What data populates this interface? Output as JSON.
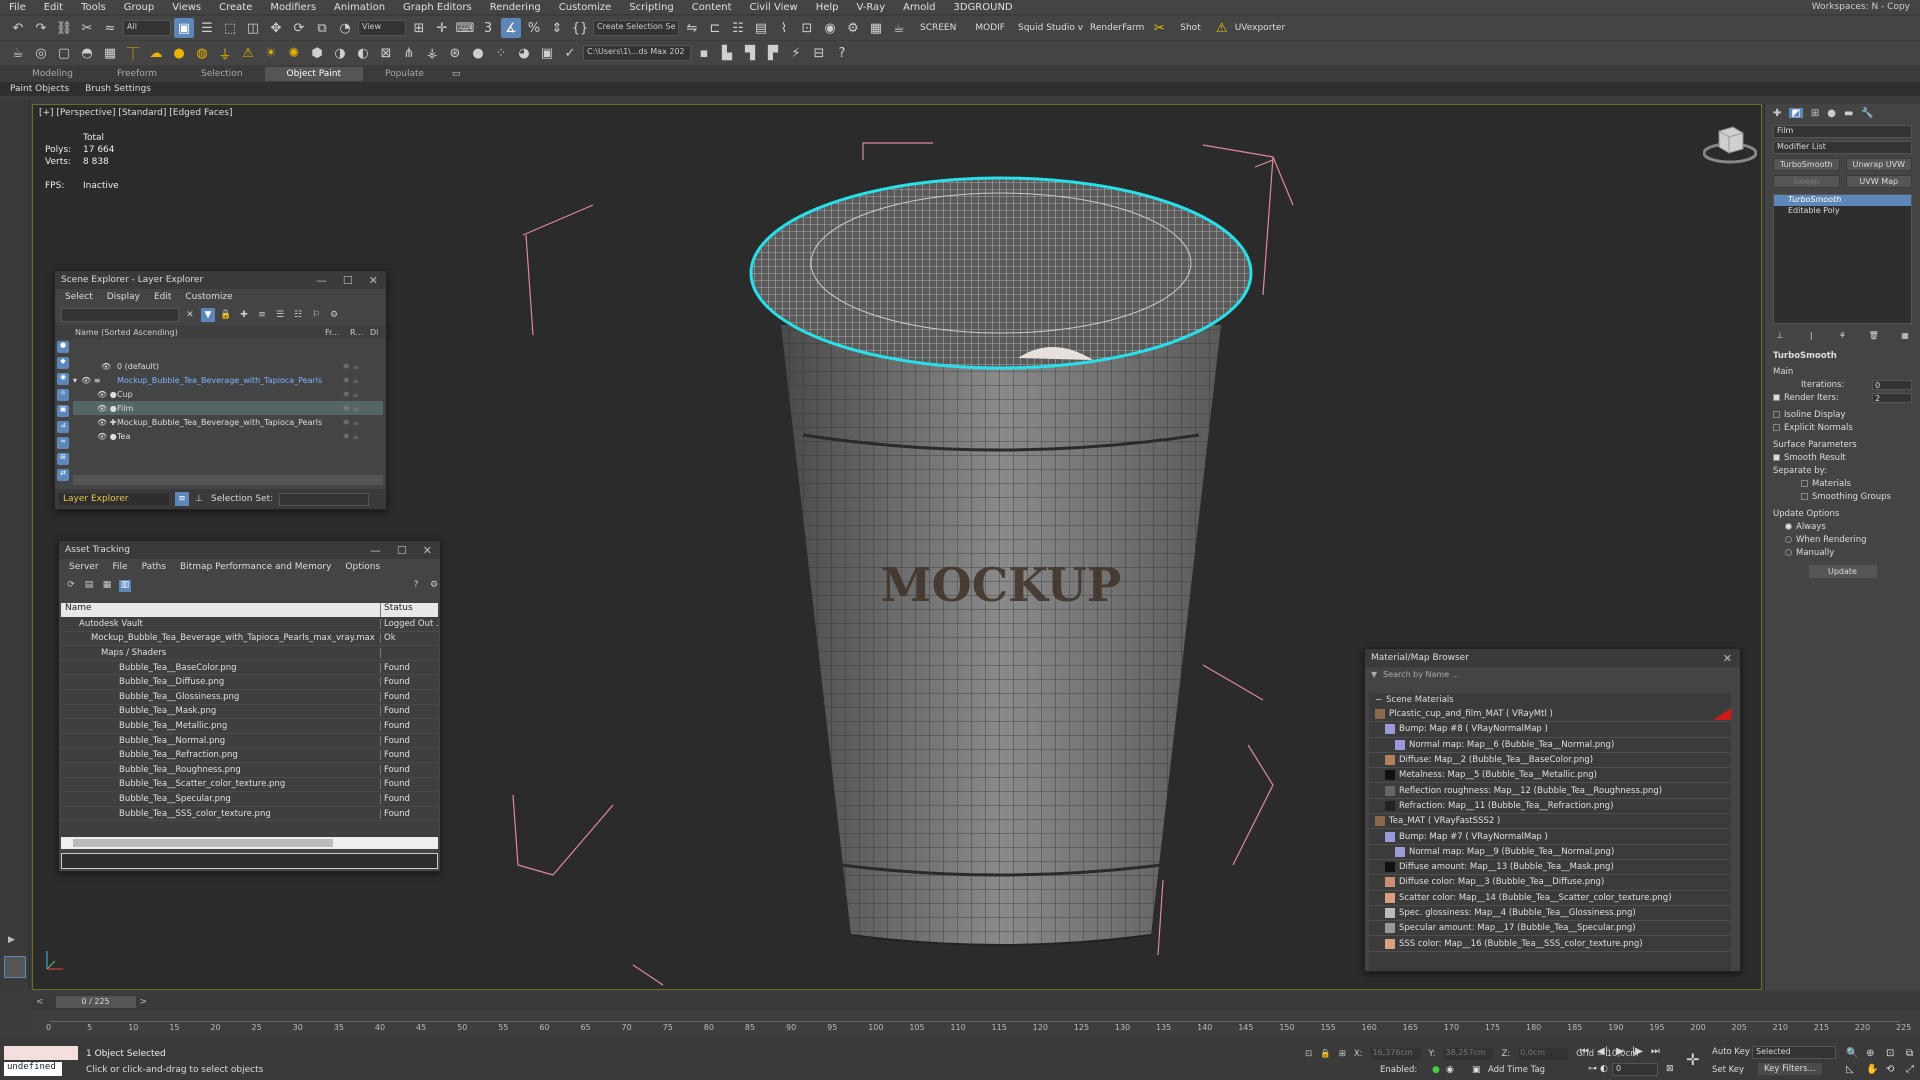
{
  "menubar": {
    "items": [
      "File",
      "Edit",
      "Tools",
      "Group",
      "Views",
      "Create",
      "Modifiers",
      "Animation",
      "Graph Editors",
      "Rendering",
      "Customize",
      "Scripting",
      "Content",
      "Civil View",
      "Help",
      "V-Ray",
      "Arnold",
      "3DGROUND"
    ],
    "workspaces": "Workspaces:  N - Copy"
  },
  "toolbar1": {
    "filter_value": "All",
    "view_value": "View",
    "selection_set_placeholder": "Create Selection Se",
    "screen_label": "SCREEN",
    "modif_label": "MODIF",
    "squid_label": "Squid Studio v",
    "renderfarm_label": "RenderFarm",
    "shot_label": "Shot",
    "uvexporter_label": "UVexporter"
  },
  "toolbar2": {
    "path_value": "C:\\Users\\1\\...ds Max 202"
  },
  "ribbon": {
    "tabs": [
      "Modeling",
      "Freeform",
      "Selection",
      "Object Paint",
      "Populate"
    ],
    "active_tab": "Object Paint",
    "subtabs": [
      "Paint Objects",
      "Brush Settings"
    ]
  },
  "viewport": {
    "label": "[+] [Perspective] [Standard] [Edged Faces]",
    "stats": {
      "total_label": "Total",
      "polys_label": "Polys:",
      "polys_value": "17 664",
      "verts_label": "Verts:",
      "verts_value": "8 838",
      "fps_label": "FPS:",
      "fps_value": "Inactive"
    },
    "cup_text": "MOCKUP"
  },
  "scene_explorer": {
    "title": "Scene Explorer - Layer Explorer",
    "menu": [
      "Select",
      "Display",
      "Edit",
      "Customize"
    ],
    "columns": [
      "Name (Sorted Ascending)",
      "Fr...",
      "R...",
      "Di"
    ],
    "rows": [
      {
        "label": "0 (default)",
        "indent": 1
      },
      {
        "label": "Mockup_Bubble_Tea_Beverage_with_Tapioca_Pearls",
        "indent": 0
      },
      {
        "label": "Cup",
        "indent": 2
      },
      {
        "label": "Film",
        "indent": 2
      },
      {
        "label": "Mockup_Bubble_Tea_Beverage_with_Tapioca_Pearls",
        "indent": 2
      },
      {
        "label": "Tea",
        "indent": 2
      }
    ],
    "footer_layer": "Layer Explorer",
    "selection_set_label": "Selection Set:"
  },
  "asset_tracking": {
    "title": "Asset Tracking",
    "menu": [
      "Server",
      "File",
      "Paths",
      "Bitmap Performance and Memory",
      "Options"
    ],
    "columns": [
      "Name",
      "Status"
    ],
    "rows": [
      {
        "name": "Autodesk Vault",
        "status": "Logged Out ..."
      },
      {
        "name": "Mockup_Bubble_Tea_Beverage_with_Tapioca_Pearls_max_vray.max",
        "status": "Ok"
      },
      {
        "name": "Maps / Shaders",
        "status": ""
      },
      {
        "name": "Bubble_Tea__BaseColor.png",
        "status": "Found"
      },
      {
        "name": "Bubble_Tea__Diffuse.png",
        "status": "Found"
      },
      {
        "name": "Bubble_Tea__Glossiness.png",
        "status": "Found"
      },
      {
        "name": "Bubble_Tea__Mask.png",
        "status": "Found"
      },
      {
        "name": "Bubble_Tea__Metallic.png",
        "status": "Found"
      },
      {
        "name": "Bubble_Tea__Normal.png",
        "status": "Found"
      },
      {
        "name": "Bubble_Tea__Refraction.png",
        "status": "Found"
      },
      {
        "name": "Bubble_Tea__Roughness.png",
        "status": "Found"
      },
      {
        "name": "Bubble_Tea__Scatter_color_texture.png",
        "status": "Found"
      },
      {
        "name": "Bubble_Tea__Specular.png",
        "status": "Found"
      },
      {
        "name": "Bubble_Tea__SSS_color_texture.png",
        "status": "Found"
      }
    ]
  },
  "material_browser": {
    "title": "Material/Map Browser",
    "search_placeholder": "Search by Name ...",
    "section": "Scene Materials",
    "rows": [
      {
        "label": "Plcastic_cup_and_film_MAT  ( VRayMtl )",
        "swatch": "#8a6a4a",
        "indent": 0
      },
      {
        "label": "Bump: Map #8  ( VRayNormalMap )",
        "swatch": "#9a9ad8",
        "indent": 1
      },
      {
        "label": "Normal map: Map__6 (Bubble_Tea__Normal.png)",
        "swatch": "#9a9ad8",
        "indent": 2
      },
      {
        "label": "Diffuse: Map__2 (Bubble_Tea__BaseColor.png)",
        "swatch": "#b08060",
        "indent": 1
      },
      {
        "label": "Metalness: Map__5 (Bubble_Tea__Metallic.png)",
        "swatch": "#111111",
        "indent": 1
      },
      {
        "label": "Reflection roughness: Map__12 (Bubble_Tea__Roughness.png)",
        "swatch": "#666666",
        "indent": 1
      },
      {
        "label": "Refraction: Map__11 (Bubble_Tea__Refraction.png)",
        "swatch": "#222222",
        "indent": 1
      },
      {
        "label": "Tea_MAT  ( VRayFastSSS2 )",
        "swatch": "#8a6a4a",
        "indent": 0
      },
      {
        "label": "Bump: Map #7  ( VRayNormalMap )",
        "swatch": "#9a9ad8",
        "indent": 1
      },
      {
        "label": "Normal map: Map__9 (Bubble_Tea__Normal.png)",
        "swatch": "#9a9ad8",
        "indent": 2
      },
      {
        "label": "Diffuse amount: Map__13 (Bubble_Tea__Mask.png)",
        "swatch": "#111111",
        "indent": 1
      },
      {
        "label": "Diffuse color: Map__3 (Bubble_Tea__Diffuse.png)",
        "swatch": "#c89070",
        "indent": 1
      },
      {
        "label": "Scatter color: Map__14 (Bubble_Tea__Scatter_color_texture.png)",
        "swatch": "#d8a080",
        "indent": 1
      },
      {
        "label": "Spec. glossiness: Map__4 (Bubble_Tea__Glossiness.png)",
        "swatch": "#bbbbbb",
        "indent": 1
      },
      {
        "label": "Specular amount: Map__17 (Bubble_Tea__Specular.png)",
        "swatch": "#999999",
        "indent": 1
      },
      {
        "label": "SSS color: Map__16 (Bubble_Tea__SSS_color_texture.png)",
        "swatch": "#d8a080",
        "indent": 1
      }
    ]
  },
  "command_panel": {
    "object_name": "Film",
    "modifier_list": "Modifier List",
    "buttons": [
      "TurboSmooth",
      "Unwrap UVW",
      "Sweep",
      "UVW Map"
    ],
    "stack": [
      "TurboSmooth",
      "Editable Poly"
    ],
    "rollout_title": "TurboSmooth",
    "main_label": "Main",
    "iterations_label": "Iterations:",
    "iterations_value": "0",
    "render_iters_label": "Render Iters:",
    "render_iters_value": "2",
    "isoline_label": "Isoline Display",
    "explicit_label": "Explicit Normals",
    "surface_label": "Surface Parameters",
    "smooth_label": "Smooth Result",
    "separate_label": "Separate by:",
    "materials_label": "Materials",
    "smoothing_label": "Smoothing Groups",
    "update_options_label": "Update Options",
    "always_label": "Always",
    "when_rendering_label": "When Rendering",
    "manually_label": "Manually",
    "update_button": "Update"
  },
  "timeline": {
    "frame_indicator": "0 / 225",
    "ticks": [
      "0",
      "5",
      "10",
      "15",
      "20",
      "25",
      "30",
      "35",
      "40",
      "45",
      "50",
      "55",
      "60",
      "65",
      "70",
      "75",
      "80",
      "85",
      "90",
      "95",
      "100",
      "105",
      "110",
      "115",
      "120",
      "125",
      "130",
      "135",
      "140",
      "145",
      "150",
      "155",
      "160",
      "165",
      "170",
      "175",
      "180",
      "185",
      "190",
      "195",
      "200",
      "205",
      "210",
      "215",
      "220",
      "225"
    ]
  },
  "statusbar": {
    "maxscript_value": "undefined",
    "selected_text": "1 Object Selected",
    "hint_text": "Click or click-and-drag to select objects",
    "x_label": "X:",
    "x_value": "16,376cm",
    "y_label": "Y:",
    "y_value": "38,257cm",
    "z_label": "Z:",
    "z_value": "0,0cm",
    "grid_text": "Grid = 10,0cm",
    "enabled_label": "Enabled:",
    "add_time_tag": "Add Time Tag",
    "frame_value": "0",
    "auto_key": "Auto Key",
    "selected_dropdown": "Selected",
    "set_key": "Set Key",
    "key_filters": "Key Filters..."
  }
}
